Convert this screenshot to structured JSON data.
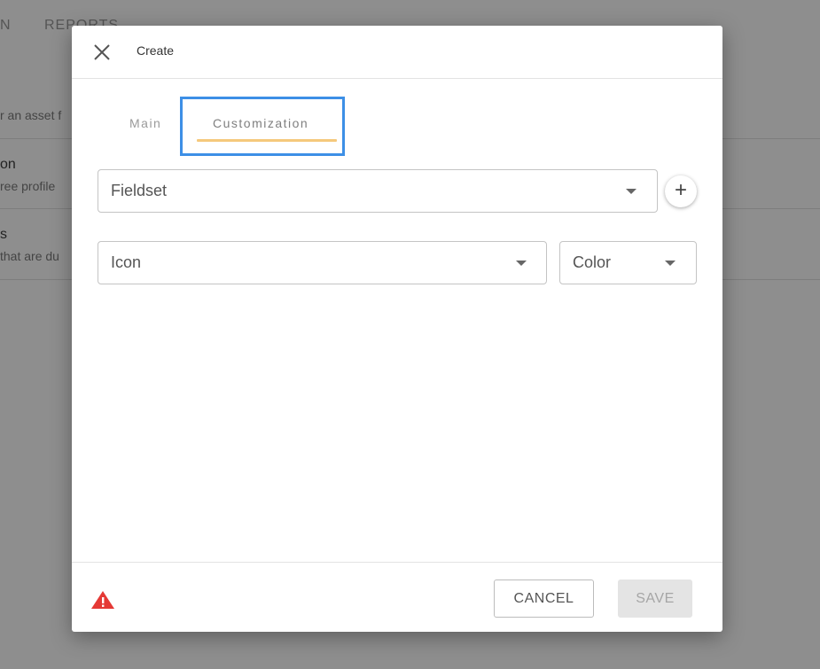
{
  "background": {
    "nav_left": "N",
    "nav_reports": "REPORTS",
    "subtitle": "r an asset f",
    "rows": [
      {
        "title": "on",
        "sub": "ree profile"
      },
      {
        "title": "s",
        "sub": "that are du"
      }
    ]
  },
  "dialog": {
    "title": "Create",
    "tabs": [
      "Main",
      "Customization"
    ],
    "active_tab": "Customization",
    "fieldset_value": "Fieldset",
    "icon_value": "Icon",
    "color_value": "Color",
    "add_symbol": "+",
    "cancel_label": "CANCEL",
    "save_label": "SAVE"
  },
  "colors": {
    "tab_indicator": "#f5c97c",
    "highlight_border": "#3d8fe6",
    "warning": "#e53935"
  }
}
